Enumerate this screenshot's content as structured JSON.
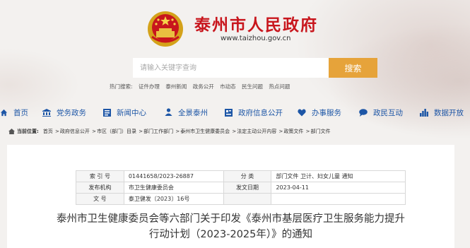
{
  "header": {
    "site_title": "泰州市人民政府",
    "site_url": "www.taizhou.gov.cn"
  },
  "search": {
    "placeholder": "请输入关键字查询",
    "button_label": "搜索",
    "hot_label": "热门搜索:",
    "hot_items": [
      "证件办理",
      "泰州新闻",
      "政务公开",
      "市动态",
      "民生问题",
      "热点问题"
    ]
  },
  "nav": {
    "items": [
      {
        "label": "首页",
        "icon": "home-icon"
      },
      {
        "label": "党务政务",
        "icon": "building-icon"
      },
      {
        "label": "新闻中心",
        "icon": "news-icon"
      },
      {
        "label": "全景泰州",
        "icon": "person-icon"
      },
      {
        "label": "政府信息公开",
        "icon": "document-icon"
      },
      {
        "label": "办事服务",
        "icon": "heart-icon"
      },
      {
        "label": "政民互动",
        "icon": "chat-icon"
      },
      {
        "label": "数据开放",
        "icon": "chart-icon"
      }
    ]
  },
  "breadcrumb": {
    "label": "当前位置:",
    "items": [
      "首页",
      "政府信息公开",
      "市区（部门）目录",
      "部门工作部门",
      "泰州市卫生健康委员会",
      "法定主动公开内容",
      "政策文件",
      "部门文件"
    ]
  },
  "meta": {
    "index_label": "索 引 号",
    "index_value": "01441658/2023-26887",
    "category_label": "分 类",
    "category_value": "部门文件 卫计、妇女儿童 通知",
    "issuer_label": "发布机构",
    "issuer_value": "市卫生健康委员会",
    "date_label": "发文日期",
    "date_value": "2023-04-11",
    "docno_label": "文 号",
    "docno_value": "泰卫健发〔2023〕16号"
  },
  "document": {
    "title_line1": "泰州市卫生健康委员会等六部门关于印发《泰州市基层医疗卫生服务能力提升",
    "title_line2": "行动计划（2023-2025年）》的通知"
  },
  "colors": {
    "title_red": "#c8161d",
    "nav_blue": "#1d56a6",
    "search_orange": "#e6a33a"
  }
}
